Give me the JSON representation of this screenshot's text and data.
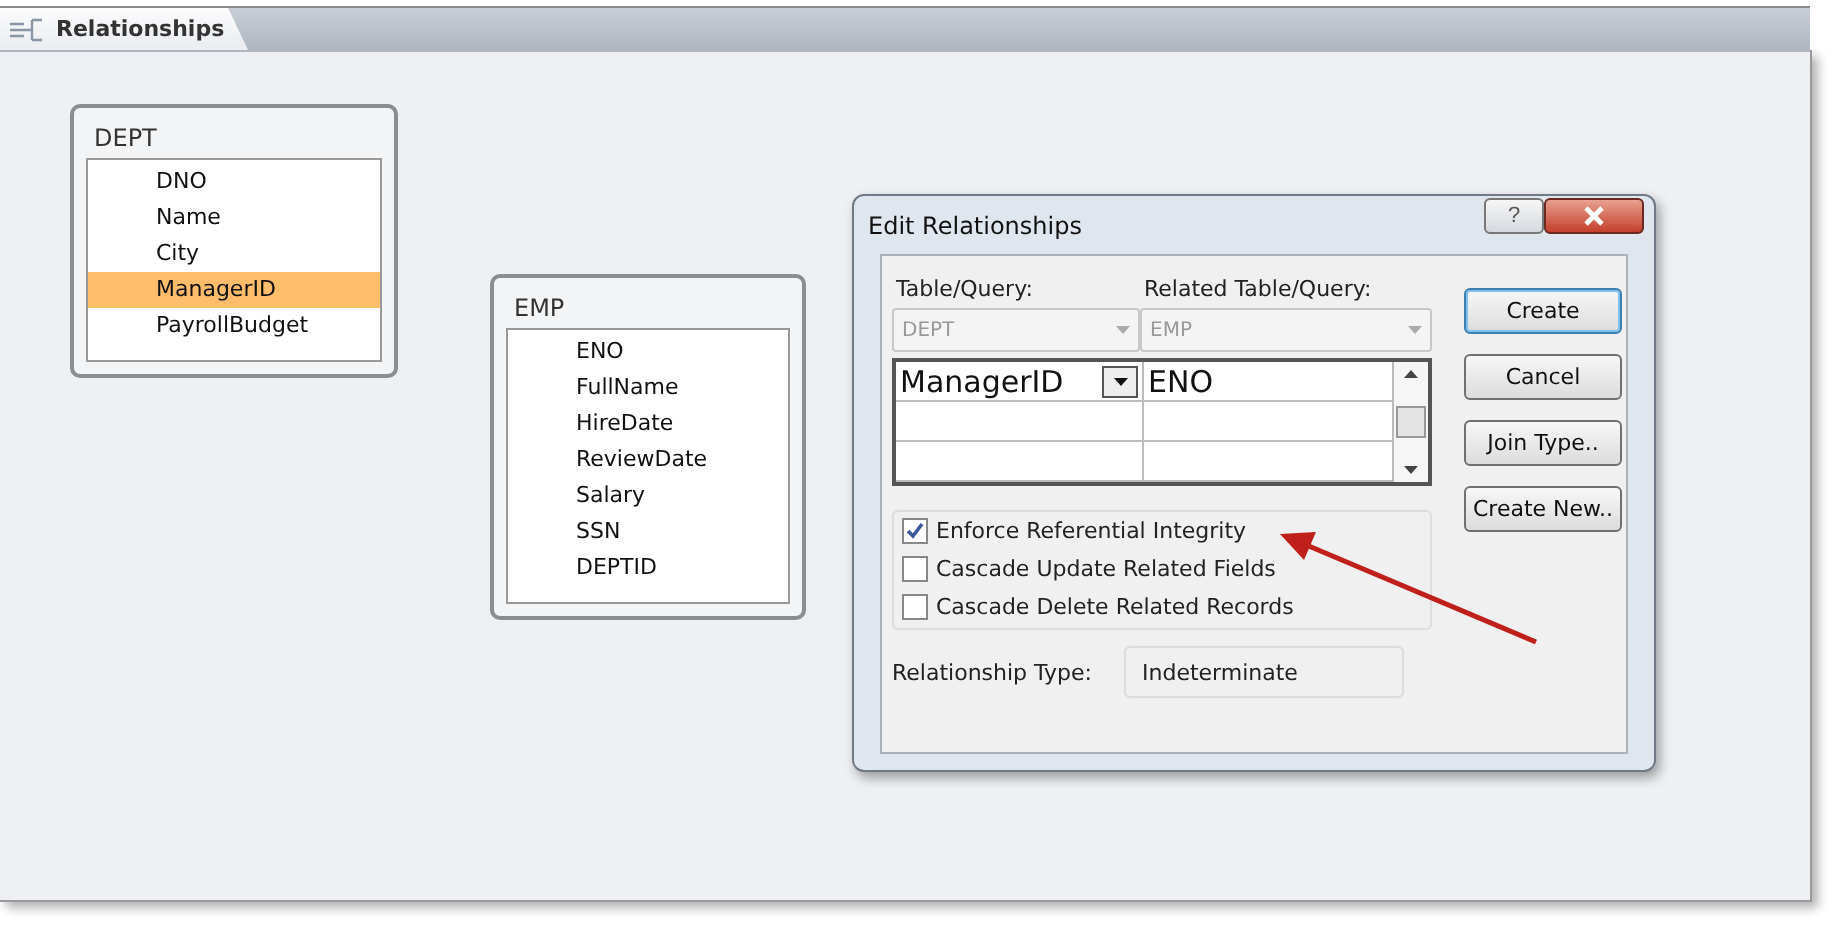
{
  "tab": {
    "title": "Relationships"
  },
  "tables": [
    {
      "name": "DEPT",
      "fields": [
        {
          "name": "DNO",
          "selected": false
        },
        {
          "name": "Name",
          "selected": false
        },
        {
          "name": "City",
          "selected": false
        },
        {
          "name": "ManagerID",
          "selected": true
        },
        {
          "name": "PayrollBudget",
          "selected": false
        }
      ]
    },
    {
      "name": "EMP",
      "fields": [
        {
          "name": "ENO",
          "selected": false
        },
        {
          "name": "FullName",
          "selected": false
        },
        {
          "name": "HireDate",
          "selected": false
        },
        {
          "name": "ReviewDate",
          "selected": false
        },
        {
          "name": "Salary",
          "selected": false
        },
        {
          "name": "SSN",
          "selected": false
        },
        {
          "name": "DEPTID",
          "selected": false
        }
      ]
    }
  ],
  "dialog": {
    "title": "Edit Relationships",
    "help_button": "?",
    "table_label": "Table/Query:",
    "related_label": "Related Table/Query:",
    "table_value": "DEPT",
    "related_value": "EMP",
    "rows": [
      {
        "field": "ManagerID",
        "related": "ENO"
      }
    ],
    "options": [
      {
        "label": "Enforce Referential Integrity",
        "checked": true
      },
      {
        "label": "Cascade Update Related Fields",
        "checked": false
      },
      {
        "label": "Cascade Delete Related Records",
        "checked": false
      }
    ],
    "relationship_type_label": "Relationship Type:",
    "relationship_type": "Indeterminate",
    "buttons": [
      {
        "label": "Create",
        "default": true
      },
      {
        "label": "Cancel",
        "default": false
      },
      {
        "label": "Join Type..",
        "default": false
      },
      {
        "label": "Create New..",
        "default": false
      }
    ]
  }
}
